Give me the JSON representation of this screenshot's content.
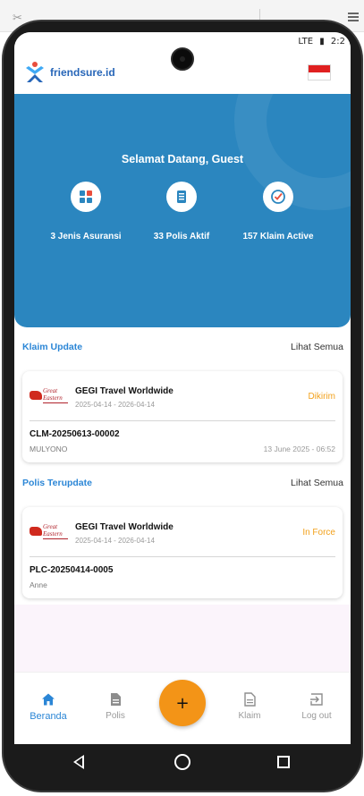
{
  "status_bar": {
    "network": "LTE",
    "time": "2:2"
  },
  "app": {
    "brand_name": "friendsure.id",
    "language_flag": "Indonesia"
  },
  "hero": {
    "welcome": "Selamat Datang, Guest",
    "stats": [
      {
        "icon": "grid-icon",
        "label": "3 Jenis Asuransi"
      },
      {
        "icon": "document-list-icon",
        "label": "33 Polis Aktif"
      },
      {
        "icon": "check-badge-icon",
        "label": "157 Klaim Active"
      }
    ]
  },
  "claims_section": {
    "title": "Klaim Update",
    "see_all": "Lihat Semua",
    "card": {
      "brand_line1": "Great",
      "brand_line2": "Eastern",
      "product": "GEGI Travel Worldwide",
      "period": "2025-04-14 - 2026-04-14",
      "status": "Dikirim",
      "code": "CLM-20250613-00002",
      "name": "MULYONO",
      "timestamp": "13 June 2025 - 06:52"
    }
  },
  "policies_section": {
    "title": "Polis Terupdate",
    "see_all": "Lihat Semua",
    "card": {
      "brand_line1": "Great",
      "brand_line2": "Eastern",
      "product": "GEGI Travel Worldwide",
      "period": "2025-04-14 - 2026-04-14",
      "status": "In Force",
      "code": "PLC-20250414-0005",
      "name": "Anne"
    }
  },
  "bottom_nav": {
    "items": [
      {
        "label": "Beranda",
        "icon": "home-icon",
        "active": true
      },
      {
        "label": "Polis",
        "icon": "document-icon",
        "active": false
      },
      {
        "label": "Klaim",
        "icon": "file-icon",
        "active": false
      },
      {
        "label": "Log out",
        "icon": "logout-icon",
        "active": false
      }
    ],
    "fab_symbol": "+"
  },
  "colors": {
    "primary": "#2b86bf",
    "accent_blue": "#2b86d6",
    "status_orange": "#f2a11c",
    "fab": "#f39417"
  }
}
